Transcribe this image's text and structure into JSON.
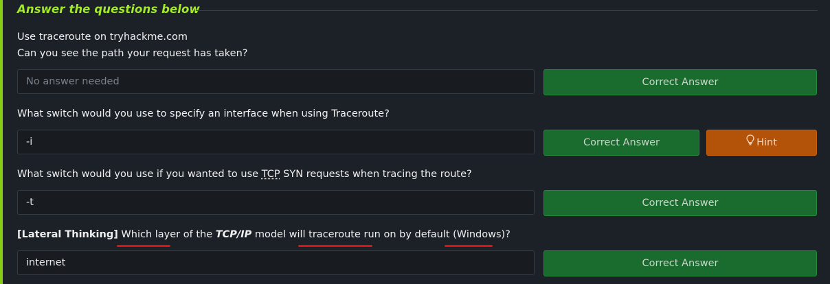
{
  "section": {
    "heading": "Answer the questions below"
  },
  "questions": [
    {
      "line1": "Use traceroute on tryhackme.com",
      "line2": "Can you see the path your request has taken?",
      "answer_placeholder": "No answer needed",
      "answer_value": "",
      "button_label": "Correct Answer"
    },
    {
      "text": "What switch would you use to specify an interface when using Traceroute?",
      "answer_value": "-i",
      "button_label": "Correct Answer",
      "hint_label": "Hint"
    },
    {
      "text_before": "What switch would you use if you wanted to use ",
      "text_abbr": "TCP",
      "text_after": " SYN requests when tracing the route?",
      "answer_value": "-t",
      "button_label": "Correct Answer"
    },
    {
      "bold_prefix": "[Lateral Thinking]",
      "text_a": " Which layer of the ",
      "italic_term": "TCP/IP",
      "text_b": " model will traceroute run on by default (Windows)?",
      "answer_value": "internet",
      "button_label": "Correct Answer"
    }
  ],
  "colors": {
    "accent_green": "#88cc14",
    "correct_button": "#1a6b2e",
    "hint_button": "#b35209",
    "annotation_red": "#d81414"
  },
  "icons": {
    "hint": "lightbulb-icon"
  }
}
